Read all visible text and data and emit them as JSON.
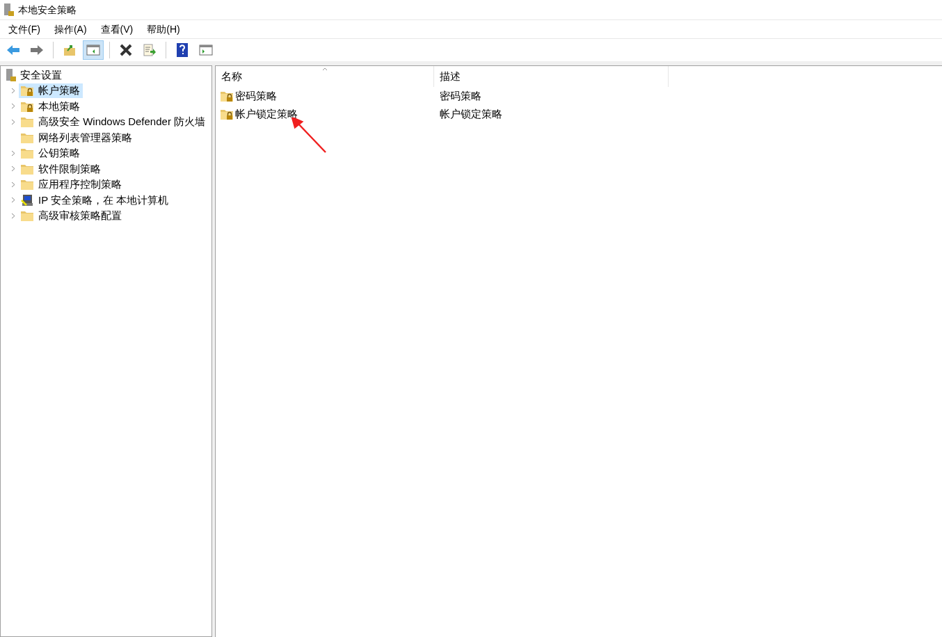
{
  "window": {
    "title": "本地安全策略"
  },
  "menu": [
    "文件(F)",
    "操作(A)",
    "查看(V)",
    "帮助(H)"
  ],
  "toolbar": [
    {
      "kind": "back",
      "pressed": false
    },
    {
      "kind": "forward",
      "pressed": false
    },
    {
      "kind": "up",
      "pressed": false
    },
    {
      "kind": "tree",
      "pressed": true
    },
    {
      "kind": "delete",
      "pressed": false
    },
    {
      "kind": "export",
      "pressed": false
    },
    {
      "kind": "help",
      "pressed": false
    },
    {
      "kind": "pane",
      "pressed": false
    }
  ],
  "tree": {
    "label": "安全设置",
    "children": [
      {
        "label": "帐户策略",
        "kind": "locked",
        "expandable": true,
        "selected": true
      },
      {
        "label": "本地策略",
        "kind": "locked",
        "expandable": true,
        "selected": false
      },
      {
        "label": "高级安全 Windows Defender 防火墙",
        "kind": "folder",
        "expandable": true,
        "selected": false
      },
      {
        "label": "网络列表管理器策略",
        "kind": "folder",
        "expandable": false,
        "selected": false
      },
      {
        "label": "公钥策略",
        "kind": "folder",
        "expandable": true,
        "selected": false
      },
      {
        "label": "软件限制策略",
        "kind": "folder",
        "expandable": true,
        "selected": false
      },
      {
        "label": "应用程序控制策略",
        "kind": "folder",
        "expandable": true,
        "selected": false
      },
      {
        "label": "IP 安全策略，在 本地计算机",
        "kind": "ip",
        "expandable": true,
        "selected": false
      },
      {
        "label": "高级审核策略配置",
        "kind": "folder",
        "expandable": true,
        "selected": false
      }
    ]
  },
  "list": {
    "columns": [
      "名称",
      "描述"
    ],
    "rows": [
      {
        "name": "密码策略",
        "description": "密码策略"
      },
      {
        "name": "帐户锁定策略",
        "description": "帐户锁定策略"
      }
    ]
  }
}
